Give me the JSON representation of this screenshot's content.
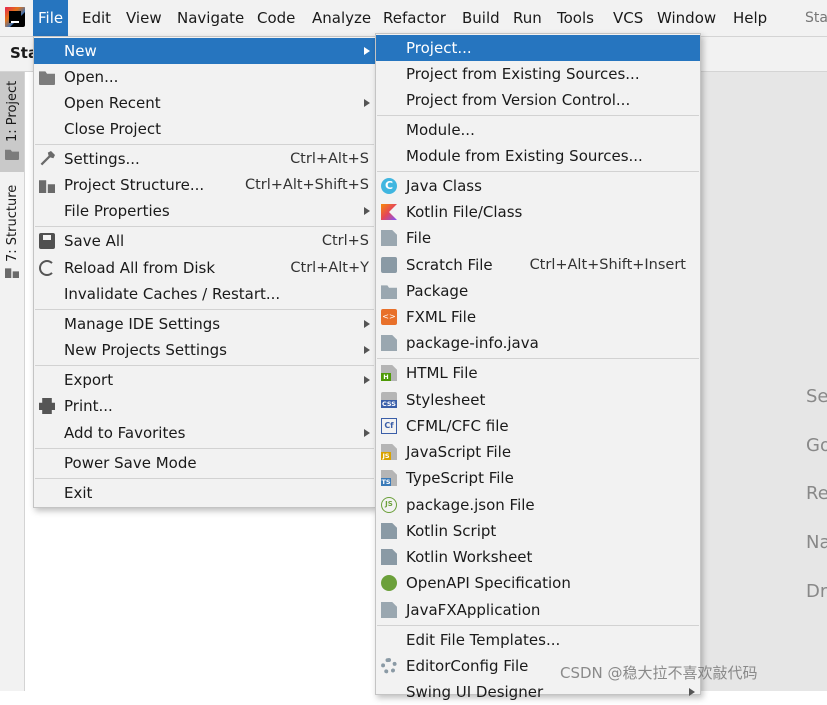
{
  "window": {
    "title_fragment": "Sta",
    "breadcrumb": "Sta"
  },
  "menubar": {
    "items": [
      "File",
      "Edit",
      "View",
      "Navigate",
      "Code",
      "Analyze",
      "Refactor",
      "Build",
      "Run",
      "Tools",
      "VCS",
      "Window",
      "Help"
    ],
    "active": "File"
  },
  "left_strip": {
    "project_tab": "1: Project",
    "structure_tab": "7: Structure"
  },
  "content_hints": [
    "Se",
    "Go",
    "Re",
    "Na",
    "Dr"
  ],
  "file_menu": {
    "items": [
      {
        "label": "New",
        "shortcut": "",
        "submenu": true,
        "icon": "none",
        "selected": true
      },
      {
        "label": "Open...",
        "shortcut": "",
        "submenu": false,
        "icon": "folder-icon"
      },
      {
        "label": "Open Recent",
        "shortcut": "",
        "submenu": true,
        "icon": "none"
      },
      {
        "label": "Close Project",
        "shortcut": "",
        "submenu": false,
        "icon": "none"
      },
      {
        "label": "Settings...",
        "shortcut": "Ctrl+Alt+S",
        "submenu": false,
        "icon": "wrench-icon"
      },
      {
        "label": "Project Structure...",
        "shortcut": "Ctrl+Alt+Shift+S",
        "submenu": false,
        "icon": "project-structure-icon"
      },
      {
        "label": "File Properties",
        "shortcut": "",
        "submenu": true,
        "icon": "none"
      },
      {
        "label": "Save All",
        "shortcut": "Ctrl+S",
        "submenu": false,
        "icon": "save-icon"
      },
      {
        "label": "Reload All from Disk",
        "shortcut": "Ctrl+Alt+Y",
        "submenu": false,
        "icon": "reload-icon"
      },
      {
        "label": "Invalidate Caches / Restart...",
        "shortcut": "",
        "submenu": false,
        "icon": "none"
      },
      {
        "label": "Manage IDE Settings",
        "shortcut": "",
        "submenu": true,
        "icon": "none"
      },
      {
        "label": "New Projects Settings",
        "shortcut": "",
        "submenu": true,
        "icon": "none"
      },
      {
        "label": "Export",
        "shortcut": "",
        "submenu": true,
        "icon": "none"
      },
      {
        "label": "Print...",
        "shortcut": "",
        "submenu": false,
        "icon": "print-icon"
      },
      {
        "label": "Add to Favorites",
        "shortcut": "",
        "submenu": true,
        "icon": "none"
      },
      {
        "label": "Power Save Mode",
        "shortcut": "",
        "submenu": false,
        "icon": "none"
      },
      {
        "label": "Exit",
        "shortcut": "",
        "submenu": false,
        "icon": "none"
      }
    ]
  },
  "new_submenu": {
    "items": [
      {
        "label": "Project...",
        "shortcut": "",
        "icon": "none",
        "selected": true
      },
      {
        "label": "Project from Existing Sources...",
        "shortcut": "",
        "icon": "none"
      },
      {
        "label": "Project from Version Control...",
        "shortcut": "",
        "icon": "none"
      },
      {
        "label": "Module...",
        "shortcut": "",
        "icon": "none"
      },
      {
        "label": "Module from Existing Sources...",
        "shortcut": "",
        "icon": "none"
      },
      {
        "label": "Java Class",
        "shortcut": "",
        "icon": "java-class-icon"
      },
      {
        "label": "Kotlin File/Class",
        "shortcut": "",
        "icon": "kotlin-file-icon"
      },
      {
        "label": "File",
        "shortcut": "",
        "icon": "file-icon"
      },
      {
        "label": "Scratch File",
        "shortcut": "Ctrl+Alt+Shift+Insert",
        "icon": "scratch-file-icon"
      },
      {
        "label": "Package",
        "shortcut": "",
        "icon": "package-icon"
      },
      {
        "label": "FXML File",
        "shortcut": "",
        "icon": "fxml-icon"
      },
      {
        "label": "package-info.java",
        "shortcut": "",
        "icon": "java-file-icon"
      },
      {
        "label": "HTML File",
        "shortcut": "",
        "icon": "html-file-icon"
      },
      {
        "label": "Stylesheet",
        "shortcut": "",
        "icon": "css-icon"
      },
      {
        "label": "CFML/CFC file",
        "shortcut": "",
        "icon": "cfml-icon"
      },
      {
        "label": "JavaScript File",
        "shortcut": "",
        "icon": "javascript-icon"
      },
      {
        "label": "TypeScript File",
        "shortcut": "",
        "icon": "typescript-icon"
      },
      {
        "label": "package.json File",
        "shortcut": "",
        "icon": "nodejs-icon"
      },
      {
        "label": "Kotlin Script",
        "shortcut": "",
        "icon": "kotlin-script-icon"
      },
      {
        "label": "Kotlin Worksheet",
        "shortcut": "",
        "icon": "kotlin-worksheet-icon"
      },
      {
        "label": "OpenAPI Specification",
        "shortcut": "",
        "icon": "openapi-icon"
      },
      {
        "label": "JavaFXApplication",
        "shortcut": "",
        "icon": "java-file-icon"
      },
      {
        "label": "Edit File Templates...",
        "shortcut": "",
        "icon": "none"
      },
      {
        "label": "EditorConfig File",
        "shortcut": "",
        "icon": "gear-icon"
      },
      {
        "label": "Swing UI Designer",
        "shortcut": "",
        "icon": "none"
      }
    ]
  },
  "watermark": "CSDN @稳大拉不喜欢敲代码"
}
